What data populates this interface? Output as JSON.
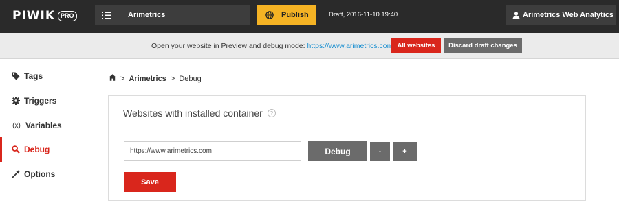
{
  "header": {
    "logo_text": "PIWIK",
    "logo_badge": "PRO",
    "site_name": "Arimetrics",
    "publish_label": "Publish",
    "draft_info": "Draft, 2016-11-10 19:40",
    "account_name": "Arimetrics Web Analytics"
  },
  "infobar": {
    "message": "Open your website in Preview and debug mode: ",
    "url": "https://www.arimetrics.com",
    "all_websites_label": "All websites",
    "discard_label": "Discard draft changes"
  },
  "sidebar": {
    "items": [
      {
        "label": "Tags",
        "icon": "tag-icon"
      },
      {
        "label": "Triggers",
        "icon": "gear-icon"
      },
      {
        "label": "Variables",
        "icon": "variable-icon",
        "icon_text": "(x)"
      },
      {
        "label": "Debug",
        "icon": "search-icon",
        "active": true
      },
      {
        "label": "Options",
        "icon": "wrench-icon"
      }
    ]
  },
  "breadcrumb": {
    "sep1": ">",
    "site": "Arimetrics",
    "sep2": ">",
    "current": "Debug"
  },
  "card": {
    "title": "Websites with installed container",
    "help_glyph": "?",
    "url_value": "https://www.arimetrics.com",
    "debug_label": "Debug",
    "minus_label": "-",
    "plus_label": "+",
    "save_label": "Save"
  },
  "colors": {
    "topbar": "#2a2a2a",
    "publish": "#f5b324",
    "accent_red": "#d9261c",
    "button_gray": "#6b6b6b",
    "link_blue": "#1a8fd0"
  }
}
